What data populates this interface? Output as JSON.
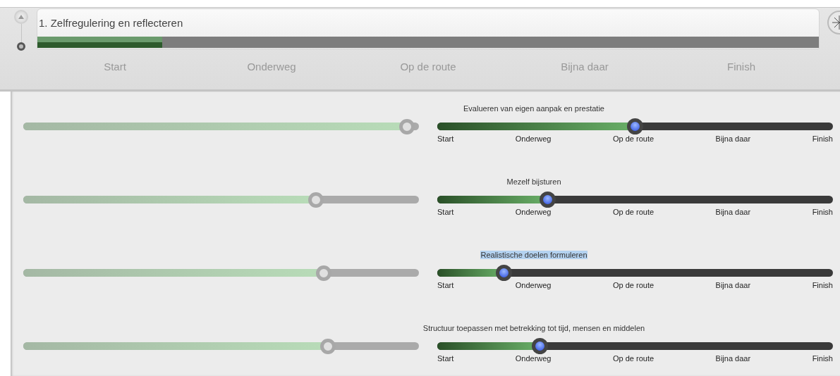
{
  "header": {
    "title": "1. Zelfregulering en reflecteren",
    "level": 0.16,
    "stages": [
      "Start",
      "Onderweg",
      "Op de route",
      "Bijna daar",
      "Finish"
    ]
  },
  "rows": [
    {
      "title": "Evalueren van eigen aanpak en prestatie",
      "highlighted": false,
      "left_slider": {
        "level": 0.97
      },
      "right_slider": {
        "level": 0.5
      },
      "stages": [
        "Start",
        "Onderweg",
        "Op de route",
        "Bijna daar",
        "Finish"
      ]
    },
    {
      "title": "Mezelf bijsturen",
      "highlighted": false,
      "left_slider": {
        "level": 0.74
      },
      "right_slider": {
        "level": 0.28
      },
      "stages": [
        "Start",
        "Onderweg",
        "Op de route",
        "Bijna daar",
        "Finish"
      ]
    },
    {
      "title": "Realistische doelen formuleren",
      "highlighted": true,
      "left_slider": {
        "level": 0.76
      },
      "right_slider": {
        "level": 0.17
      },
      "stages": [
        "Start",
        "Onderweg",
        "Op de route",
        "Bijna daar",
        "Finish"
      ]
    },
    {
      "title": "Structuur toepassen met betrekking tot tijd, mensen en middelen",
      "highlighted": false,
      "left_slider": {
        "level": 0.77
      },
      "right_slider": {
        "level": 0.26
      },
      "stages": [
        "Start",
        "Onderweg",
        "Op de route",
        "Bijna daar",
        "Finish"
      ]
    }
  ]
}
